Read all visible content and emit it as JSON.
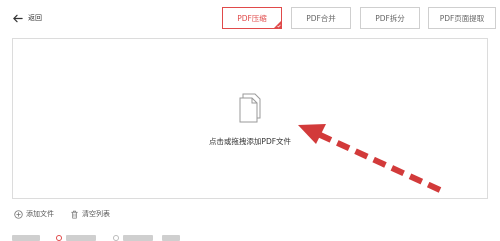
{
  "header": {
    "back_label": "返回",
    "tabs": [
      {
        "label": "PDF压缩",
        "active": true
      },
      {
        "label": "PDF合并",
        "active": false
      },
      {
        "label": "PDF拆分",
        "active": false
      },
      {
        "label": "PDF页面提取",
        "active": false
      }
    ]
  },
  "dropzone": {
    "hint": "点击或拖拽添加PDF文件",
    "icon": "document-icon"
  },
  "actions": {
    "add_file": "添加文件",
    "clear_list": "清空列表"
  },
  "colors": {
    "accent": "#e04a4a",
    "arrow": "#d23a3a",
    "border": "#dcdcdc",
    "text": "#333333"
  }
}
